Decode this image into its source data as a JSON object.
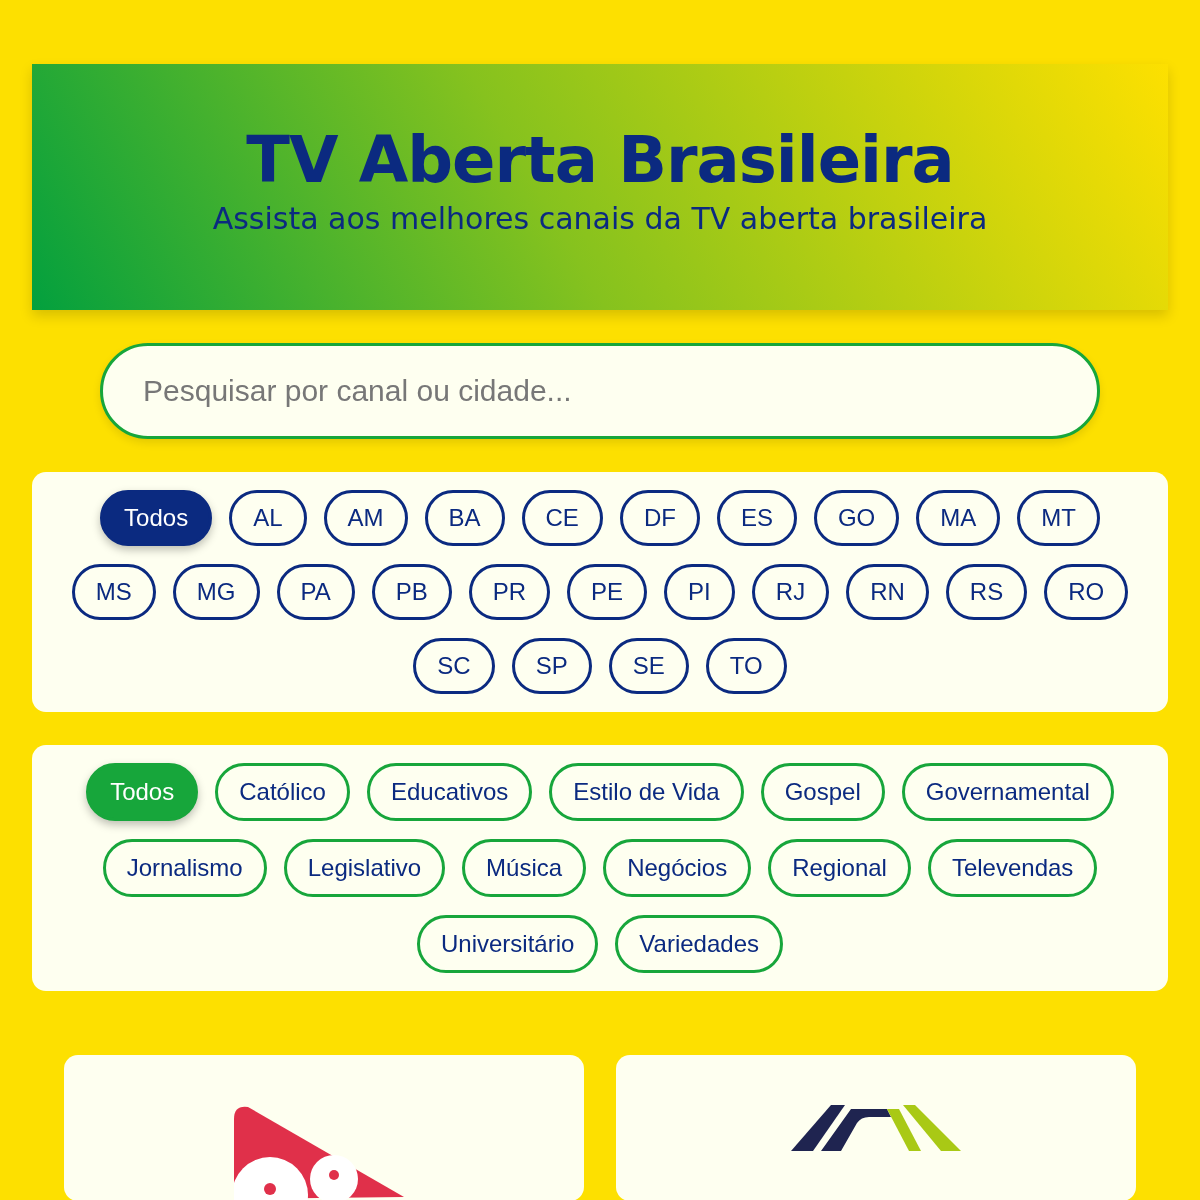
{
  "header": {
    "title": "TV Aberta Brasileira",
    "subtitle": "Assista aos melhores canais da TV aberta brasileira"
  },
  "search": {
    "placeholder": "Pesquisar por canal ou cidade..."
  },
  "state_filters": [
    {
      "label": "Todos",
      "selected": true
    },
    {
      "label": "AL",
      "selected": false
    },
    {
      "label": "AM",
      "selected": false
    },
    {
      "label": "BA",
      "selected": false
    },
    {
      "label": "CE",
      "selected": false
    },
    {
      "label": "DF",
      "selected": false
    },
    {
      "label": "ES",
      "selected": false
    },
    {
      "label": "GO",
      "selected": false
    },
    {
      "label": "MA",
      "selected": false
    },
    {
      "label": "MT",
      "selected": false
    },
    {
      "label": "MS",
      "selected": false
    },
    {
      "label": "MG",
      "selected": false
    },
    {
      "label": "PA",
      "selected": false
    },
    {
      "label": "PB",
      "selected": false
    },
    {
      "label": "PR",
      "selected": false
    },
    {
      "label": "PE",
      "selected": false
    },
    {
      "label": "PI",
      "selected": false
    },
    {
      "label": "RJ",
      "selected": false
    },
    {
      "label": "RN",
      "selected": false
    },
    {
      "label": "RS",
      "selected": false
    },
    {
      "label": "RO",
      "selected": false
    },
    {
      "label": "SC",
      "selected": false
    },
    {
      "label": "SP",
      "selected": false
    },
    {
      "label": "SE",
      "selected": false
    },
    {
      "label": "TO",
      "selected": false
    }
  ],
  "category_filters": [
    {
      "label": "Todos",
      "selected": true
    },
    {
      "label": "Católico",
      "selected": false
    },
    {
      "label": "Educativos",
      "selected": false
    },
    {
      "label": "Estilo de Vida",
      "selected": false
    },
    {
      "label": "Gospel",
      "selected": false
    },
    {
      "label": "Governamental",
      "selected": false
    },
    {
      "label": "Jornalismo",
      "selected": false
    },
    {
      "label": "Legislativo",
      "selected": false
    },
    {
      "label": "Música",
      "selected": false
    },
    {
      "label": "Negócios",
      "selected": false
    },
    {
      "label": "Regional",
      "selected": false
    },
    {
      "label": "Televendas",
      "selected": false
    },
    {
      "label": "Universitário",
      "selected": false
    },
    {
      "label": "Variedades",
      "selected": false
    }
  ],
  "channels": [
    {
      "kind": "triangle"
    },
    {
      "kind": "stripes"
    }
  ]
}
